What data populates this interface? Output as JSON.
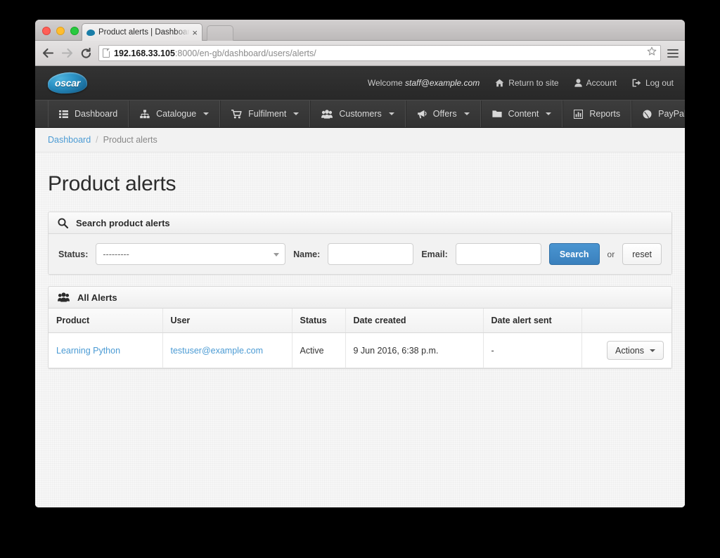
{
  "browser": {
    "tab": {
      "title": "Product alerts | Dashboard",
      "favicon": "oscar-blob-icon",
      "close_label": "×"
    },
    "new_tab_label": "",
    "toolbar": {
      "back_icon": "back-arrow-icon",
      "forward_icon": "forward-arrow-icon",
      "reload_icon": "reload-icon",
      "page_icon": "page-document-icon",
      "url_host": "192.168.33.105",
      "url_rest": ":8000/en-gb/dashboard/users/alerts/",
      "star_icon": "bookmark-star-icon",
      "menu_icon": "hamburger-menu-icon"
    }
  },
  "topbar": {
    "logo_text": "oscar",
    "welcome_prefix": "Welcome ",
    "welcome_user": "staff@example.com",
    "links": [
      {
        "label": "Return to site",
        "icon": "home-icon"
      },
      {
        "label": "Account",
        "icon": "user-icon"
      },
      {
        "label": "Log out",
        "icon": "logout-icon"
      }
    ]
  },
  "nav": {
    "items": [
      {
        "label": "Dashboard",
        "icon": "list-icon",
        "caret": false
      },
      {
        "label": "Catalogue",
        "icon": "sitemap-icon",
        "caret": true
      },
      {
        "label": "Fulfilment",
        "icon": "cart-icon",
        "caret": true
      },
      {
        "label": "Customers",
        "icon": "group-icon",
        "caret": true
      },
      {
        "label": "Offers",
        "icon": "megaphone-icon",
        "caret": true
      },
      {
        "label": "Content",
        "icon": "folder-icon",
        "caret": true
      },
      {
        "label": "Reports",
        "icon": "chart-icon",
        "caret": false
      },
      {
        "label": "PayPal",
        "icon": "globe-icon",
        "caret": true
      }
    ]
  },
  "breadcrumb": {
    "home_label": "Dashboard",
    "separator": "/",
    "current_label": "Product alerts"
  },
  "page": {
    "title": "Product alerts"
  },
  "search_panel": {
    "icon": "search-icon",
    "heading": "Search product alerts",
    "status_label": "Status:",
    "status_value": "---------",
    "name_label": "Name:",
    "name_value": "",
    "name_placeholder": "",
    "email_label": "Email:",
    "email_value": "",
    "email_placeholder": "",
    "search_button": "Search",
    "or_text": "or",
    "reset_button": "reset"
  },
  "alerts_panel": {
    "icon": "group-icon",
    "heading": "All Alerts",
    "columns": [
      "Product",
      "User",
      "Status",
      "Date created",
      "Date alert sent",
      ""
    ],
    "rows": [
      {
        "product": "Learning Python",
        "user": "testuser@example.com",
        "status": "Active",
        "date_created": "9 Jun 2016, 6:38 p.m.",
        "date_alert_sent": "-",
        "actions_label": "Actions"
      }
    ]
  },
  "colors": {
    "accent_blue": "#4b9bd4",
    "button_blue": "#3a80bd",
    "nav_dark": "#333333",
    "topbar_dark": "#2b2b2b",
    "page_bg": "#f7f7f7"
  }
}
